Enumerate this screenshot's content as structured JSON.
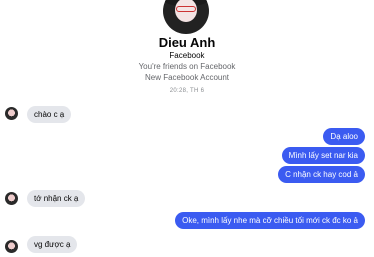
{
  "contact": {
    "name": "Dieu Anh",
    "source": "Facebook",
    "friends_note": "You're friends on Facebook",
    "account_note": "New Facebook Account"
  },
  "timestamp": "20:28, TH 6",
  "messages": [
    {
      "side": "in",
      "text": "chào c ạ"
    },
    {
      "side": "out",
      "text": "Dạ aloo"
    },
    {
      "side": "out",
      "text": "Mình lấy set nar kia"
    },
    {
      "side": "out",
      "text": "C nhận ck hay cod ả"
    },
    {
      "side": "in",
      "text": "tớ nhận ck ạ"
    },
    {
      "side": "out",
      "text": "Oke, mình lấy nhe mà cỡ chiều tối mới ck đc ko ả"
    },
    {
      "side": "in",
      "text": "vg được ạ"
    }
  ],
  "colors": {
    "outgoing": "#3b5bf1",
    "incoming": "#e4e6eb"
  }
}
